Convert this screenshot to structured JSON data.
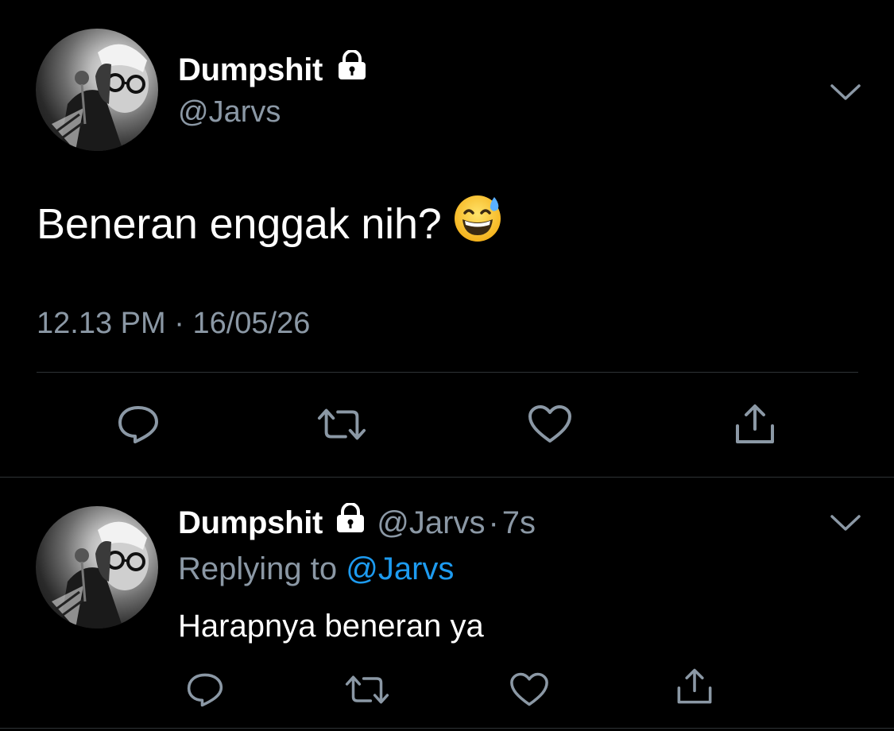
{
  "colors": {
    "background": "#000000",
    "text_primary": "#ffffff",
    "text_secondary": "#8b98a5",
    "link": "#1d9bf0",
    "divider": "#2f3336"
  },
  "main_tweet": {
    "display_name": "Dumpshit",
    "handle": "@Jarvs",
    "text": "Beneran enggak nih?",
    "emoji": "grinning-face-with-sweat",
    "time": "12.13 PM",
    "separator": "·",
    "date": "16/05/26",
    "icons": {
      "lock": "lock-icon",
      "menu": "chevron-down-icon",
      "reply": "reply-icon",
      "retweet": "retweet-icon",
      "like": "heart-icon",
      "share": "share-icon"
    }
  },
  "reply_tweet": {
    "display_name": "Dumpshit",
    "handle": "@Jarvs",
    "separator": "·",
    "age": "7s",
    "replying_prefix": "Replying to",
    "replying_to": "@Jarvs",
    "text": "Harapnya beneran ya"
  }
}
